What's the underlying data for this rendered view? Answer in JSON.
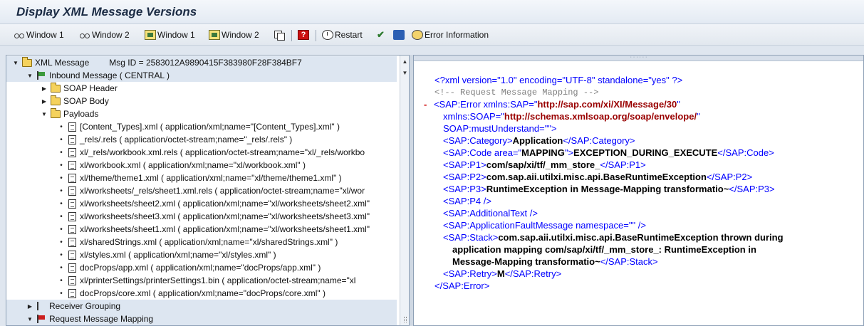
{
  "window": {
    "title": "Display XML Message Versions"
  },
  "toolbar": {
    "items": [
      {
        "label": "Window 1",
        "icon": "glasses-icon"
      },
      {
        "label": "Window 2",
        "icon": "glasses-icon"
      },
      {
        "label": "Window 1",
        "icon": "window-icon"
      },
      {
        "label": "Window 2",
        "icon": "window-icon"
      },
      {
        "label": "",
        "icon": "copy-icon"
      },
      {
        "label": "",
        "icon": "help-icon"
      },
      {
        "label": "Restart",
        "icon": "clock-icon"
      },
      {
        "label": "",
        "icon": "check-icon"
      },
      {
        "label": "",
        "icon": "refresh-icon"
      },
      {
        "label": "Error Information",
        "icon": "error-info-icon"
      }
    ]
  },
  "tree": {
    "root": {
      "label": "XML Message",
      "msg_id_label": "Msg ID = 2583012A9890415F383980F28F384BF7"
    },
    "inbound": "Inbound Message ( CENTRAL )",
    "soap_header": "SOAP Header",
    "soap_body": "SOAP Body",
    "payloads": "Payloads",
    "files": [
      "[Content_Types].xml ( application/xml;name=\"[Content_Types].xml\" )",
      "_rels/.rels ( application/octet-stream;name=\"_rels/.rels\" )",
      "xl/_rels/workbook.xml.rels ( application/octet-stream;name=\"xl/_rels/workbo",
      "xl/workbook.xml ( application/xml;name=\"xl/workbook.xml\" )",
      "xl/theme/theme1.xml ( application/xml;name=\"xl/theme/theme1.xml\" )",
      "xl/worksheets/_rels/sheet1.xml.rels ( application/octet-stream;name=\"xl/wor",
      "xl/worksheets/sheet2.xml ( application/xml;name=\"xl/worksheets/sheet2.xml\"",
      "xl/worksheets/sheet3.xml ( application/xml;name=\"xl/worksheets/sheet3.xml\"",
      "xl/worksheets/sheet1.xml ( application/xml;name=\"xl/worksheets/sheet1.xml\"",
      "xl/sharedStrings.xml ( application/xml;name=\"xl/sharedStrings.xml\" )",
      "xl/styles.xml ( application/xml;name=\"xl/styles.xml\" )",
      "docProps/app.xml ( application/xml;name=\"docProps/app.xml\" )",
      "xl/printerSettings/printerSettings1.bin ( application/octet-stream;name=\"xl",
      "docProps/core.xml ( application/xml;name=\"docProps/core.xml\" )"
    ],
    "receiver_grouping": "Receiver Grouping",
    "request_mapping": "Request Message Mapping"
  },
  "xml": {
    "decl": "<?xml version=\"1.0\" encoding=\"UTF-8\" standalone=\"yes\" ?>",
    "comment": "<!--  Request Message Mapping   -->",
    "collapse": "-",
    "error_open_a": "<SAP:Error xmlns:SAP=\"",
    "error_ns": "http://sap.com/xi/XI/Message/30",
    "error_open_b": "\"",
    "soap_ns_a": "xmlns:SOAP=\"",
    "soap_ns": "http://schemas.xmlsoap.org/soap/envelope/",
    "soap_ns_b": "\"",
    "must_understand": "SOAP:mustUnderstand=\"\">",
    "category_open": "<SAP:Category>",
    "category_val": "Application",
    "category_close": "</SAP:Category>",
    "code_open_a": "<SAP:Code area=\"",
    "code_area": "MAPPING",
    "code_open_b": "\">",
    "code_val": "EXCEPTION_DURING_EXECUTE",
    "code_close": "</SAP:Code>",
    "p1_open": "<SAP:P1>",
    "p1_val": "com/sap/xi/tf/_mm_store_",
    "p1_close": "</SAP:P1>",
    "p2_open": "<SAP:P2>",
    "p2_val": "com.sap.aii.utilxi.misc.api.BaseRuntimeException",
    "p2_close": "</SAP:P2>",
    "p3_open": "<SAP:P3>",
    "p3_val": "RuntimeException in Message-Mapping transformatio~",
    "p3_close": "</SAP:P3>",
    "p4": "<SAP:P4 />",
    "additional_text": "<SAP:AdditionalText />",
    "app_fault": "<SAP:ApplicationFaultMessage namespace=\"\" />",
    "stack_open": "<SAP:Stack>",
    "stack_line1": "com.sap.aii.utilxi.misc.api.BaseRuntimeException thrown during",
    "stack_line2": "application mapping com/sap/xi/tf/_mm_store_: RuntimeException in",
    "stack_line3": "Message-Mapping transformatio~",
    "stack_close": "</SAP:Stack>",
    "retry_open": "<SAP:Retry>",
    "retry_val": "M",
    "retry_close": "</SAP:Retry>",
    "error_close": "</SAP:Error>"
  }
}
